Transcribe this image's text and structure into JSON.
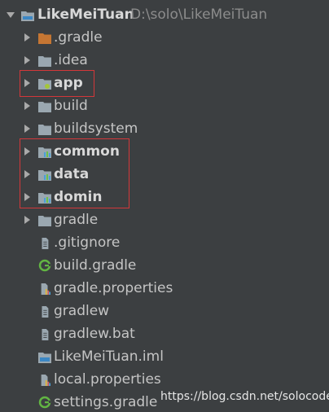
{
  "project": {
    "name": "LikeMeiTuan",
    "path": "D:\\solo\\LikeMeiTuan"
  },
  "items": [
    {
      "label": ".gradle",
      "kind": "folder-orange",
      "expandable": true,
      "bold": false
    },
    {
      "label": ".idea",
      "kind": "folder",
      "expandable": true,
      "bold": false
    },
    {
      "label": "app",
      "kind": "module-app",
      "expandable": true,
      "bold": true
    },
    {
      "label": "build",
      "kind": "folder",
      "expandable": true,
      "bold": false
    },
    {
      "label": "buildsystem",
      "kind": "folder",
      "expandable": true,
      "bold": false
    },
    {
      "label": "common",
      "kind": "module-lib",
      "expandable": true,
      "bold": true
    },
    {
      "label": "data",
      "kind": "module-lib",
      "expandable": true,
      "bold": true
    },
    {
      "label": "domin",
      "kind": "module-lib",
      "expandable": true,
      "bold": true
    },
    {
      "label": "gradle",
      "kind": "folder",
      "expandable": true,
      "bold": false
    },
    {
      "label": ".gitignore",
      "kind": "file",
      "expandable": false,
      "bold": false
    },
    {
      "label": "build.gradle",
      "kind": "gradle-file",
      "expandable": false,
      "bold": false
    },
    {
      "label": "gradle.properties",
      "kind": "properties-file",
      "expandable": false,
      "bold": false
    },
    {
      "label": "gradlew",
      "kind": "file",
      "expandable": false,
      "bold": false
    },
    {
      "label": "gradlew.bat",
      "kind": "file",
      "expandable": false,
      "bold": false
    },
    {
      "label": "LikeMeiTuan.iml",
      "kind": "iml-file",
      "expandable": false,
      "bold": false
    },
    {
      "label": "local.properties",
      "kind": "properties-file",
      "expandable": false,
      "bold": false
    },
    {
      "label": "settings.gradle",
      "kind": "gradle-file",
      "expandable": false,
      "bold": false
    }
  ],
  "watermark": "https://blog.csdn.net/solocoder",
  "colors": {
    "background": "#3c3f41",
    "text": "#c5c5c5",
    "folder": "#9aa7b0",
    "folder_orange": "#c57633",
    "gradle_green": "#62b543",
    "highlight": "#d3373a"
  }
}
